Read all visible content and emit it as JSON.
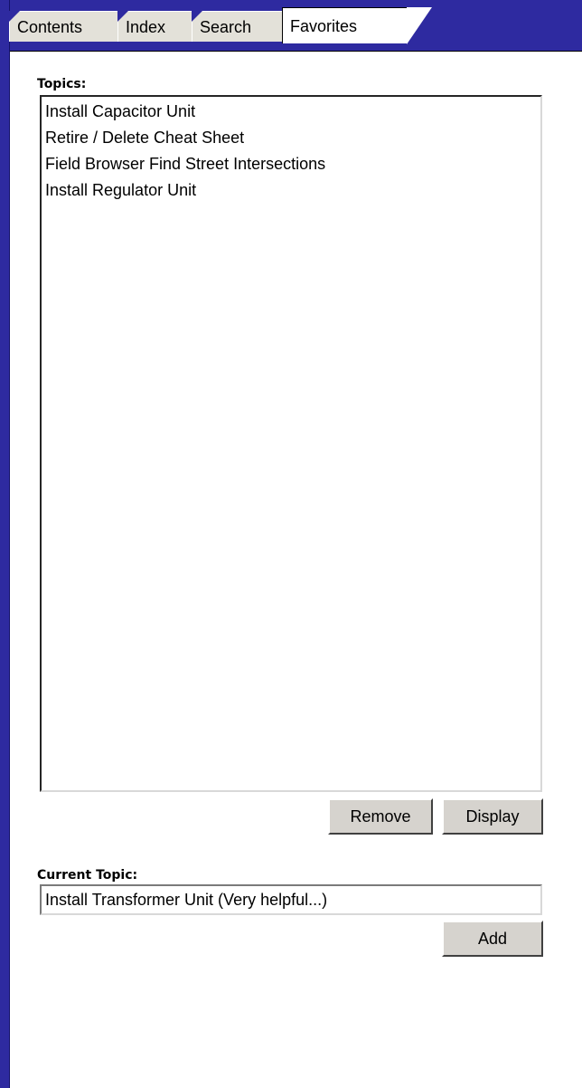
{
  "tabs": [
    {
      "label": "Contents",
      "active": false
    },
    {
      "label": "Index",
      "active": false
    },
    {
      "label": "Search",
      "active": false
    },
    {
      "label": "Favorites",
      "active": true
    }
  ],
  "topics": {
    "label": "Topics:",
    "items": [
      "Install Capacitor Unit",
      "Retire / Delete Cheat Sheet",
      "Field Browser Find Street Intersections",
      "Install Regulator Unit"
    ]
  },
  "buttons": {
    "remove": "Remove",
    "display": "Display",
    "add": "Add"
  },
  "current_topic": {
    "label": "Current Topic:",
    "value": "Install Transformer Unit (Very helpful...)"
  },
  "colors": {
    "frame_blue": "#2e2aa0",
    "tab_inactive": "#e3e1d9",
    "button_face": "#d6d3ce"
  }
}
